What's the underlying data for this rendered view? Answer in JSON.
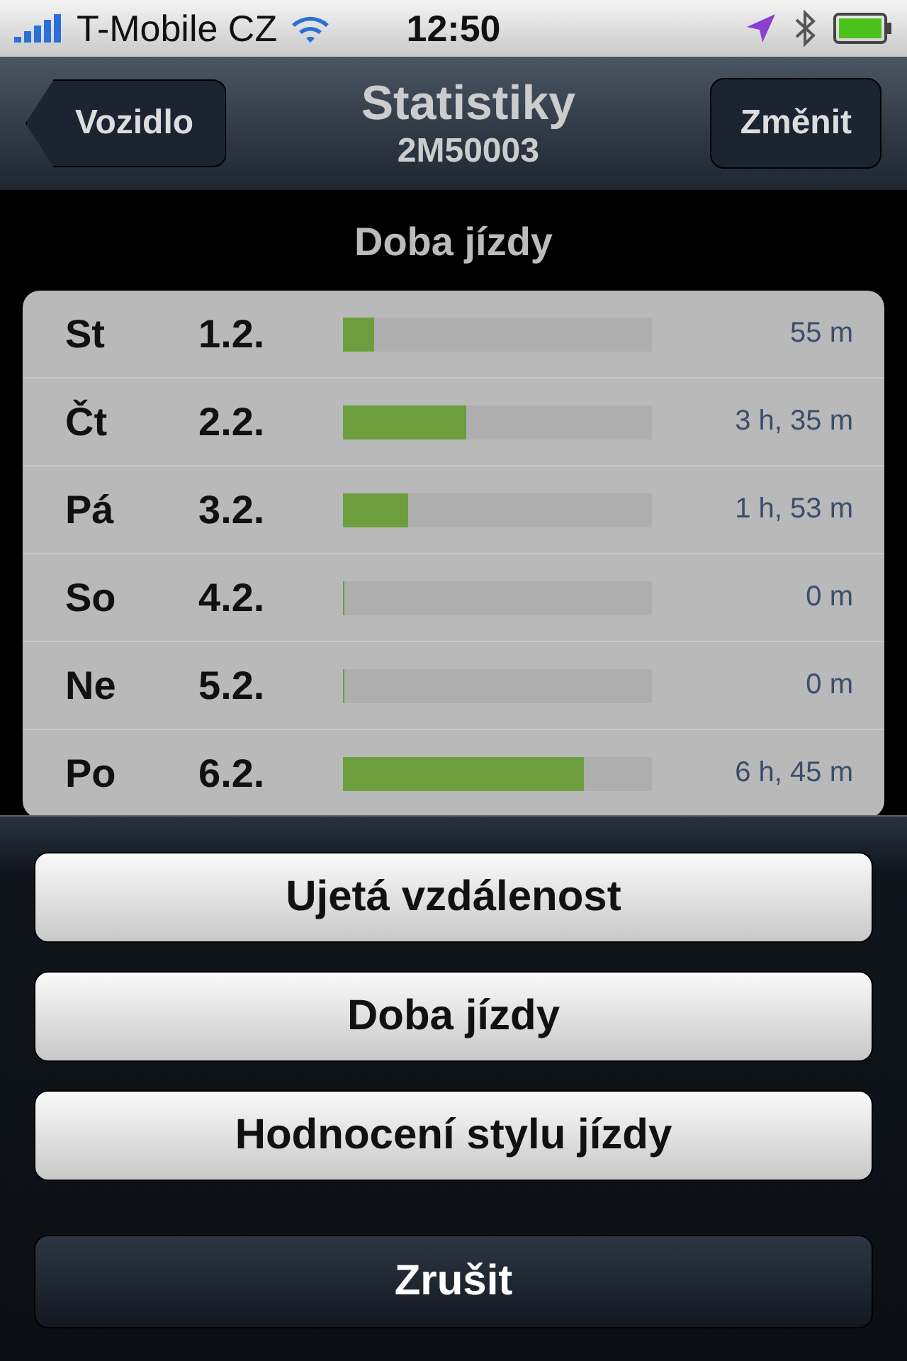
{
  "status_bar": {
    "carrier": "T-Mobile CZ",
    "time": "12:50"
  },
  "nav": {
    "back": "Vozidlo",
    "title": "Statistiky",
    "subtitle": "2M50003",
    "action": "Změnit"
  },
  "section_title": "Doba jízdy",
  "rows": [
    {
      "day": "St",
      "date": "1.2.",
      "level": 0.1,
      "value": "55 m"
    },
    {
      "day": "Čt",
      "date": "2.2.",
      "level": 0.4,
      "value": "3 h, 35 m"
    },
    {
      "day": "Pá",
      "date": "3.2.",
      "level": 0.21,
      "value": "1 h, 53 m"
    },
    {
      "day": "So",
      "date": "4.2.",
      "level": 0,
      "value": "0 m"
    },
    {
      "day": "Ne",
      "date": "5.2.",
      "level": 0,
      "value": "0 m"
    },
    {
      "day": "Po",
      "date": "6.2.",
      "level": 0.78,
      "value": "6 h, 45 m"
    }
  ],
  "sheet": {
    "options": [
      "Ujetá vzdálenost",
      "Doba jízdy",
      "Hodnocení stylu jízdy"
    ],
    "cancel": "Zrušit"
  }
}
